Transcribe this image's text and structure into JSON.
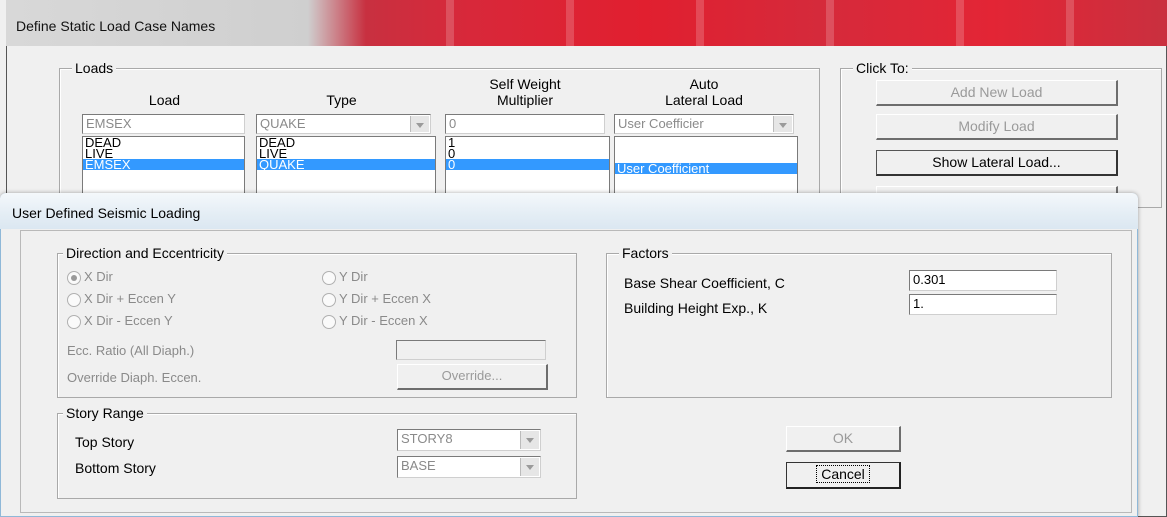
{
  "back_dialog": {
    "title": "Define Static Load Case Names",
    "loads_group": "Loads",
    "col_load": "Load",
    "col_type": "Type",
    "col_self_weight": "Self Weight\nMultiplier",
    "col_auto_lateral": "Auto\nLateral Load",
    "edit_load": "EMSEX",
    "edit_type": "QUAKE",
    "edit_self_weight": "0",
    "edit_auto_lateral": "User Coefficier",
    "rows": [
      {
        "load": "DEAD",
        "type": "DEAD",
        "self_weight": "1",
        "auto_lateral": ""
      },
      {
        "load": "LIVE",
        "type": "LIVE",
        "self_weight": "0",
        "auto_lateral": ""
      },
      {
        "load": "EMSEX",
        "type": "QUAKE",
        "self_weight": "0",
        "auto_lateral": "User Coefficient"
      }
    ],
    "click_to_group": "Click To:",
    "add_new_load": "Add New Load",
    "modify_load": "Modify Load",
    "show_lateral_load": "Show Lateral Load..."
  },
  "front_dialog": {
    "title": "User Defined Seismic Loading",
    "direction_group": "Direction and Eccentricity",
    "x_dir": "X Dir",
    "y_dir": "Y Dir",
    "x_dir_ecc_y": "X Dir + Eccen Y",
    "y_dir_ecc_x": "Y Dir + Eccen X",
    "x_dir_minus_ecc_y": "X Dir - Eccen Y",
    "y_dir_minus_ecc_x": "Y Dir - Eccen X",
    "ecc_ratio_label": "Ecc. Ratio (All Diaph.)",
    "ecc_ratio_value": "",
    "override_label": "Override Diaph. Eccen.",
    "override_button": "Override...",
    "factors_group": "Factors",
    "base_shear_label": "Base Shear Coefficient, C",
    "base_shear_value": "0.301",
    "height_exp_label": "Building Height Exp., K",
    "height_exp_value": "1.",
    "story_group": "Story Range",
    "top_story_label": "Top Story",
    "top_story_value": "STORY8",
    "bottom_story_label": "Bottom Story",
    "bottom_story_value": "BASE",
    "ok_button": "OK",
    "cancel_button": "Cancel"
  },
  "colors": {
    "selection": "#3399ff",
    "title_red": "#e11f2f"
  }
}
